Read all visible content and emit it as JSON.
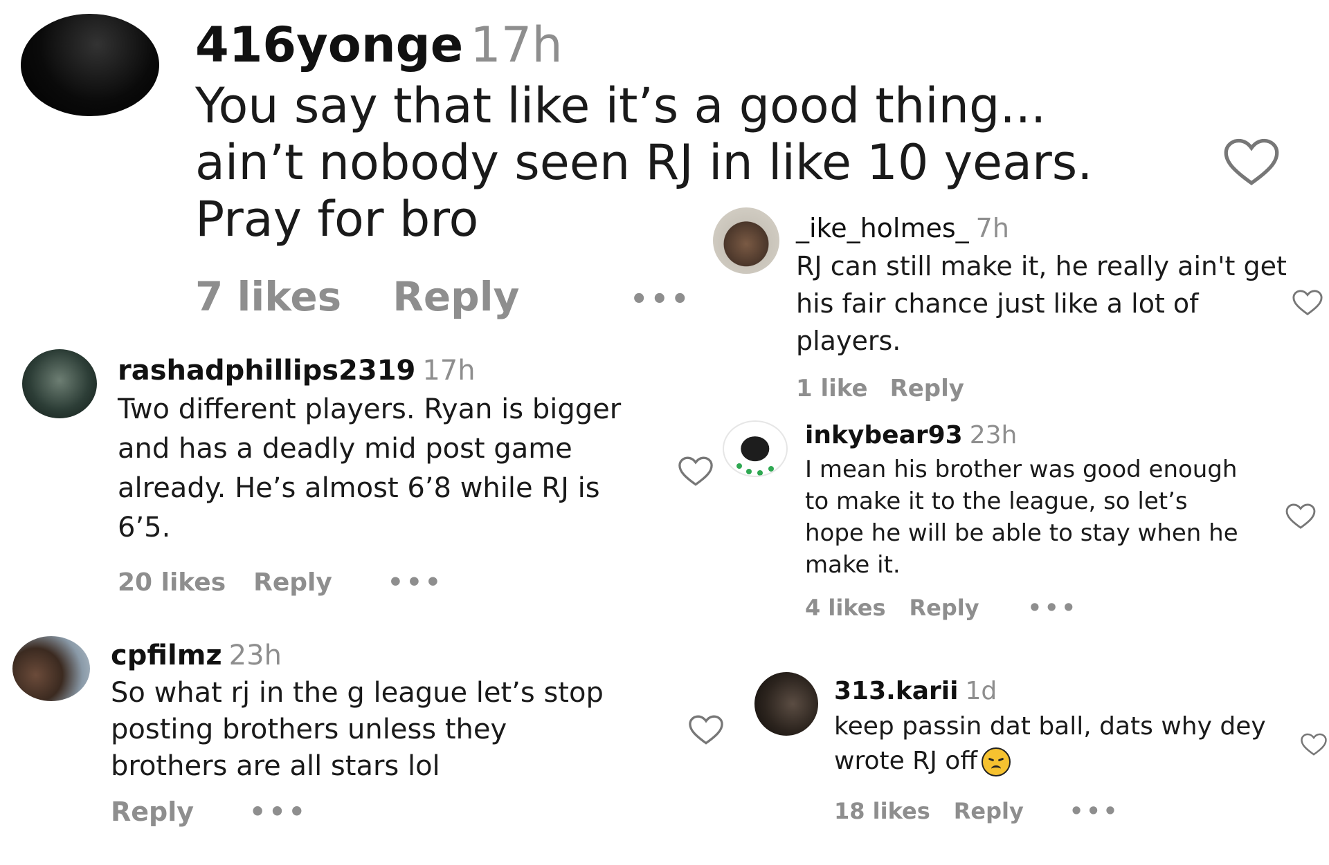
{
  "comments": [
    {
      "username": "416yonge",
      "time": "17h",
      "lines": [
        "You say that like it’s a good thing...",
        "ain’t nobody seen RJ in like 10 years.",
        "Pray for bro"
      ],
      "likes": "7 likes",
      "reply": "Reply",
      "more": "•••"
    },
    {
      "username": "rashadphillips2319",
      "time": "17h",
      "lines": [
        "Two different players. Ryan is bigger",
        "and has a deadly mid post game",
        "already. He’s almost 6’8 while RJ is",
        "6’5."
      ],
      "likes": "20 likes",
      "reply": "Reply",
      "more": "•••"
    },
    {
      "username": "cpfilmz",
      "time": "23h",
      "lines": [
        "So what rj in the g league let’s stop",
        "posting brothers unless they",
        "brothers are all stars lol"
      ],
      "reply": "Reply",
      "more": "•••"
    },
    {
      "username": "_ike_holmes_",
      "time": "7h",
      "lines": [
        "RJ can still make it, he really ain't get",
        "his fair chance just like a lot of",
        "players."
      ],
      "likes": "1 like",
      "reply": "Reply"
    },
    {
      "username": "inkybear93",
      "time": "23h",
      "lines": [
        "I mean his brother was good enough",
        "to make it to the league, so let’s",
        "hope he will be able to stay when he",
        "make it."
      ],
      "likes": "4 likes",
      "reply": "Reply",
      "more": "•••"
    },
    {
      "username": "313.karii",
      "time": "1d",
      "lines": [
        "keep passin dat ball, dats why dey",
        "wrote RJ off"
      ],
      "likes": "18 likes",
      "reply": "Reply",
      "more": "•••"
    }
  ],
  "icons": {
    "heart": "heart-icon",
    "emoji": "disappointed-face-emoji"
  },
  "colors": {
    "text": "#111111",
    "muted": "#8e8e8e",
    "background": "#ffffff"
  }
}
